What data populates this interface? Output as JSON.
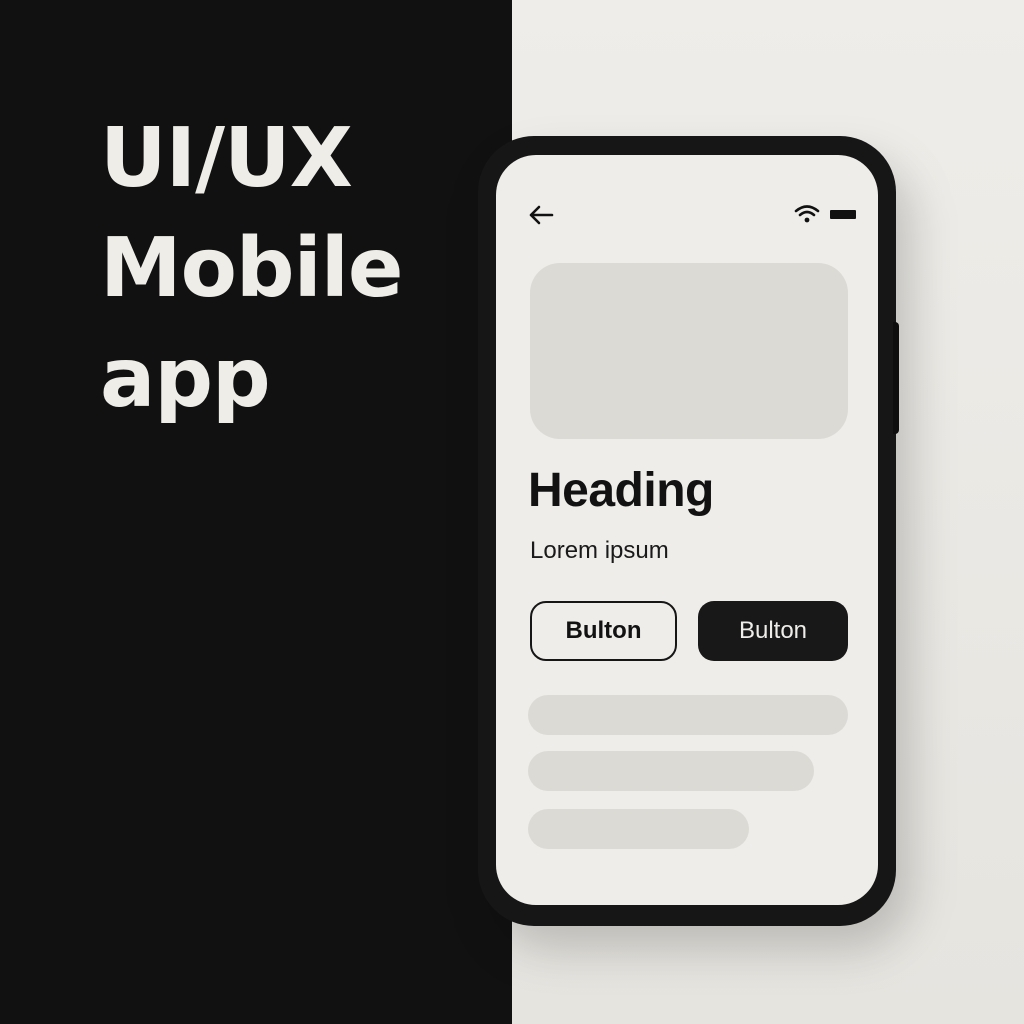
{
  "poster": {
    "title_line_1": "UI/UX",
    "title_line_2": "Mobile",
    "title_line_3": "app"
  },
  "screen": {
    "icons": {
      "back": "arrow-left-icon",
      "wifi": "wifi-icon",
      "battery": "battery-icon"
    },
    "heading": "Heading",
    "subtext": "Lorem ipsum",
    "buttons": {
      "outline_label": "Bulton",
      "filled_label": "Bulton"
    }
  },
  "colors": {
    "dark_background": "#111111",
    "light_background": "#efede9",
    "placeholder_gray": "#dcdad5",
    "primary_button": "#181818"
  }
}
